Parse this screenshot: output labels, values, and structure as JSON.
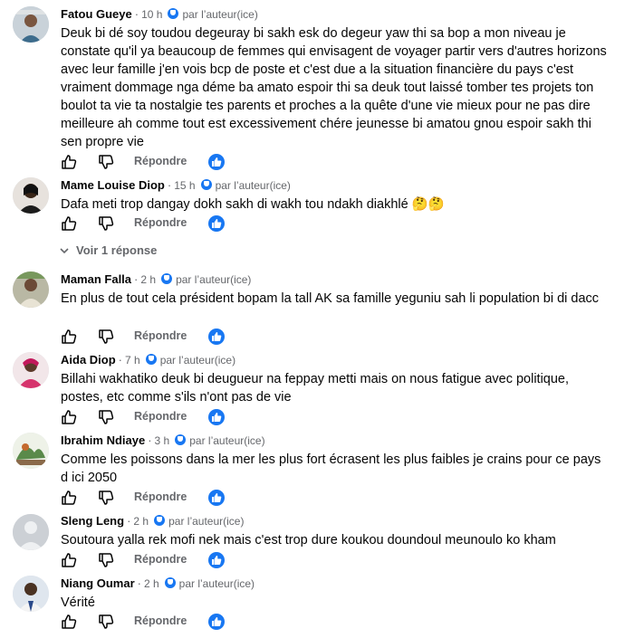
{
  "labels": {
    "by_author": "par l’auteur(ice)",
    "reply": "Répondre",
    "see_replies": "Voir 1 réponse"
  },
  "comments": [
    {
      "author": "Fatou Gueye",
      "time": "10 h",
      "text": "Deuk bi dé soy toudou degeuray bi sakh esk do degeur yaw thi sa bop a mon niveau je constate qu'il ya beaucoup de femmes qui envisagent de voyager partir vers d'autres horizons avec leur famille j'en vois bcp de poste et c'est due a la situation financière du pays c'est vraiment dommage nga déme ba amato espoir thi sa deuk tout laissé tomber tes projets ton boulot ta vie ta nostalgie tes parents et proches a la quête d'une vie mieux pour ne pas dire meilleure ah comme tout est excessivement chére jeunesse bi amatou gnou espoir sakh thi sen propre vie"
    },
    {
      "author": "Mame Louise Diop",
      "time": "15 h",
      "text": "Dafa meti trop dangay dokh sakh di wakh tou ndakh diakhlé 🤔🤔"
    },
    {
      "author": "Maman Falla",
      "time": "2 h",
      "text": "En plus de tout cela président bopam la tall AK sa famille yeguniu sah li population bi di dacc"
    },
    {
      "author": "Aida Diop",
      "time": "7 h",
      "text": "Billahi wakhatiko deuk bi deugueur na feppay metti mais on nous fatigue avec politique, postes, etc comme s'ils n'ont pas de vie"
    },
    {
      "author": "Ibrahim Ndiaye",
      "time": "3 h",
      "text": "Comme les poissons dans la mer les plus fort écrasent les plus faibles je crains pour ce pays d ici 2050"
    },
    {
      "author": "Sleng Leng",
      "time": "2 h",
      "text": "Soutoura yalla rek mofi nek mais c'est trop dure koukou doundoul meunoulo ko kham"
    },
    {
      "author": "Niang Oumar",
      "time": "2 h",
      "text": "Vérité"
    }
  ]
}
